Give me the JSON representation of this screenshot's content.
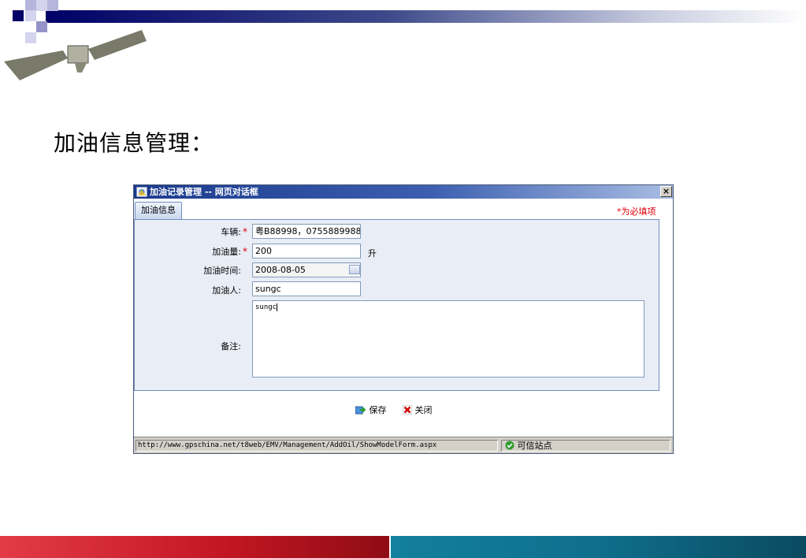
{
  "slide": {
    "title": "加油信息管理："
  },
  "dialog": {
    "title": "加油记录管理 -- 网页对话框",
    "close_label": "×",
    "tab_label": "加油信息",
    "required_note": "*为必填项",
    "fields": {
      "vehicle": {
        "label": "车辆:",
        "required_mark": "*",
        "value": "粤B88998，0755889988"
      },
      "fuel_amount": {
        "label": "加油量:",
        "required_mark": "*",
        "value": "200",
        "unit": "升"
      },
      "fuel_time": {
        "label": "加油时间:",
        "value": "2008-08-05"
      },
      "fueler": {
        "label": "加油人:",
        "value": "sungc"
      },
      "remarks": {
        "label": "备注:",
        "value": "sungc"
      }
    },
    "buttons": {
      "save": "保存",
      "close": "关闭"
    },
    "statusbar": {
      "url": "http://www.gpschina.net/t8web/EMV/Management/AddOil/ShowModelForm.aspx",
      "zone": "可信站点"
    }
  },
  "colors": {
    "titlebar": "#1b3a8c",
    "required": "#e0000a",
    "panel_bg": "#e9edf6",
    "bottom_red": "#c01622",
    "bottom_blue": "#0f6f8c"
  },
  "icons": [
    "satellite-icon",
    "dialog-app-icon",
    "calendar-icon",
    "save-icon",
    "close-x-icon",
    "trusted-site-check-icon"
  ]
}
